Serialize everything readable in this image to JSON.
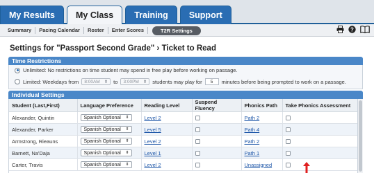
{
  "top_tabs": [
    {
      "label": "My Results",
      "active": false
    },
    {
      "label": "My Class",
      "active": true
    },
    {
      "label": "Training",
      "active": false
    },
    {
      "label": "Support",
      "active": false
    }
  ],
  "subnav": {
    "items": [
      "Summary",
      "Pacing Calendar",
      "Roster",
      "Enter Scores"
    ],
    "active_pill": "T2R Settings",
    "icons": [
      "print-icon",
      "help-icon",
      "book-icon"
    ]
  },
  "page": {
    "title": "Settings for \"Passport Second Grade\" › Ticket to Read"
  },
  "time_restrictions": {
    "header": "Time Restrictions",
    "unlimited_label": "Unlimited: No restrictions on time student may spend in free play before working on passage.",
    "limited_prefix": "Limited: Weekdays from",
    "from_time": "8:00AM",
    "to_label": "to",
    "to_time": "3:00PM",
    "play_label": "students may play for",
    "minutes_value": "5",
    "minutes_suffix": "minutes before being prompted to work on a passage."
  },
  "individual_settings": {
    "header": "Individual Settings",
    "columns": [
      "Student (Last,First)",
      "Language Preference",
      "Reading Level",
      "Suspend Fluency",
      "Phonics Path",
      "Take Phonics Assessment"
    ],
    "rows": [
      {
        "student": "Alexander, Quintin",
        "language": "Spanish Optional",
        "level": "Level 2",
        "phonics": "Path 2"
      },
      {
        "student": "Alexander, Parker",
        "language": "Spanish Optional",
        "level": "Level 5",
        "phonics": "Path 4"
      },
      {
        "student": "Armstrong, Rieauns",
        "language": "Spanish Optional",
        "level": "Level 2",
        "phonics": "Path 2"
      },
      {
        "student": "Barnett, Na'Daja",
        "language": "Spanish Optional",
        "level": "Level 1",
        "phonics": "Path 1"
      },
      {
        "student": "Carter, Travis",
        "language": "Spanish Optional",
        "level": "Level 2",
        "phonics": "Unassigned"
      }
    ]
  },
  "colors": {
    "brand_blue": "#2a6db3",
    "section_header": "#4a87c8",
    "link": "#1d56a8",
    "annotation_arrow": "#e02020"
  }
}
